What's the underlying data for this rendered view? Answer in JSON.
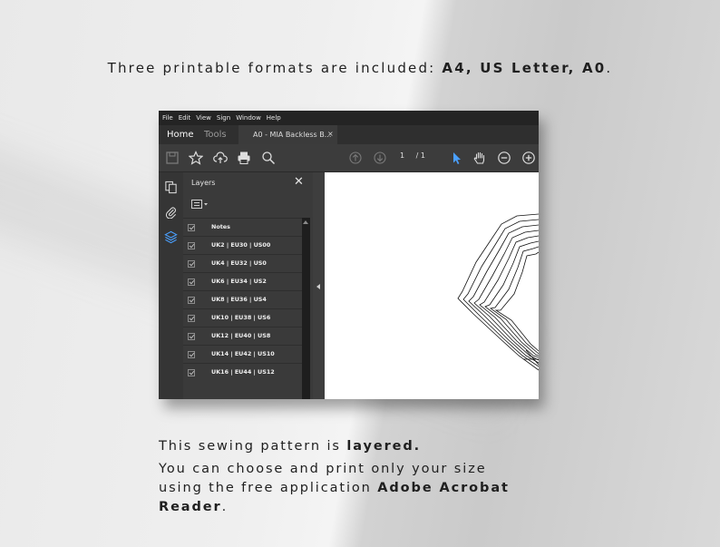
{
  "headline": {
    "text": "Three printable formats are included: ",
    "formats": "A4, US Letter, A0",
    "end": "."
  },
  "app": {
    "menu": [
      "File",
      "Edit",
      "View",
      "Sign",
      "Window",
      "Help"
    ],
    "tabs": {
      "home": "Home",
      "tools": "Tools",
      "document": "A0 - MIA Backless B...",
      "close": "×"
    },
    "toolbar": {
      "icons": [
        "save-icon",
        "star-icon",
        "upload-icon",
        "print-icon",
        "search-icon",
        "page-up-icon",
        "page-down-icon",
        "pointer-icon",
        "hand-icon",
        "zoom-out-icon",
        "zoom-in-icon"
      ],
      "current_page": "1",
      "total_pages": "/ 1"
    },
    "rail_icons": [
      "pages-icon",
      "attachment-icon",
      "layers-icon"
    ],
    "layers_panel": {
      "title": "Layers",
      "close": "✕",
      "items": [
        "Notes",
        "UK2 | EU30 | US00",
        "UK4 | EU32 | US0",
        "UK6 | EU34 | US2",
        "UK8 | EU36 | US4",
        "UK10 | EU38 | US6",
        "UK12 | EU40 | US8",
        "UK14 | EU42 | US10",
        "UK16 | EU44 | US12"
      ]
    },
    "colors": {
      "accent": "#4aa0ff",
      "panel": "#3a3a3a",
      "menubar": "#242424"
    }
  },
  "caption": {
    "line1_pre": "This sewing pattern is ",
    "line1_bold": "layered.",
    "line2": "You can choose and print only your size",
    "line3_pre": "using the free application ",
    "line3_bold": "Adobe Acrobat",
    "line4_bold": "Reader",
    "line4_post": "."
  }
}
